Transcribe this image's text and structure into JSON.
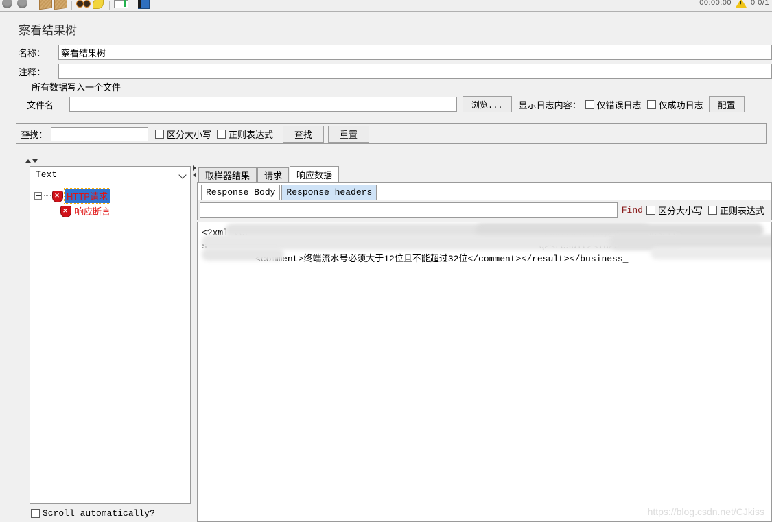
{
  "toolbar": {
    "icons": [
      "gear-grey-icon",
      "gear-grey-icon-2",
      "board-icon",
      "board-icon-2",
      "glasses-icon",
      "broom-icon",
      "meter-icon",
      "blue-pad-icon"
    ],
    "status_time": "00:00:00",
    "status_counts": "0  0/1",
    "warning_icon": "warning-triangle-icon"
  },
  "page": {
    "title": "察看结果树"
  },
  "form": {
    "name_label": "名称：",
    "name_value": "察看结果树",
    "comment_label": "注释：",
    "comment_value": "",
    "comment_placeholder": ""
  },
  "file_group": {
    "title": "所有数据写入一个文件",
    "filename_label": "文件名",
    "filename_value": "",
    "browse_button": "浏览...",
    "show_log_label": "显示日志内容：",
    "errors_only_checkbox": "仅错误日志",
    "errors_only_checked": false,
    "success_only_checkbox": "仅成功日志",
    "success_only_checked": false,
    "config_button": "配置"
  },
  "search_bar": {
    "label": "查找：",
    "value": "",
    "case_sensitive_checkbox": "区分大小写",
    "case_sensitive_checked": false,
    "regex_checkbox": "正则表达式",
    "regex_checked": false,
    "search_button": "查找",
    "reset_button": "重置"
  },
  "tree_panel": {
    "renderer_selected": "Text",
    "nodes": [
      {
        "label": "HTTP请求",
        "selected": true,
        "status": "error"
      },
      {
        "label": "响应断言",
        "selected": false,
        "status": "error"
      }
    ],
    "scroll_auto_label": "Scroll automatically?",
    "scroll_auto_checked": false
  },
  "content_panel": {
    "tabs": [
      {
        "label": "取样器结果",
        "active": false
      },
      {
        "label": "请求",
        "active": false
      },
      {
        "label": "响应数据",
        "active": true
      }
    ],
    "subtabs": [
      {
        "label": "Response Body",
        "active": true
      },
      {
        "label": "Response headers",
        "active": false
      }
    ],
    "find": {
      "value": "",
      "label": "Find",
      "case_sensitive_checkbox": "区分大小写",
      "case_sensitive_checked": false,
      "regex_checkbox": "正则表达式",
      "regex_checked": false
    },
    "response_body": "<?xml ver                                                       >barcode pay_response</re\ns                                                              q><result><id>5\n          <comment>终端流水号必须大于12位且不能超过32位</comment></result></business_"
  },
  "watermark": "https://blog.csdn.net/CJkiss"
}
